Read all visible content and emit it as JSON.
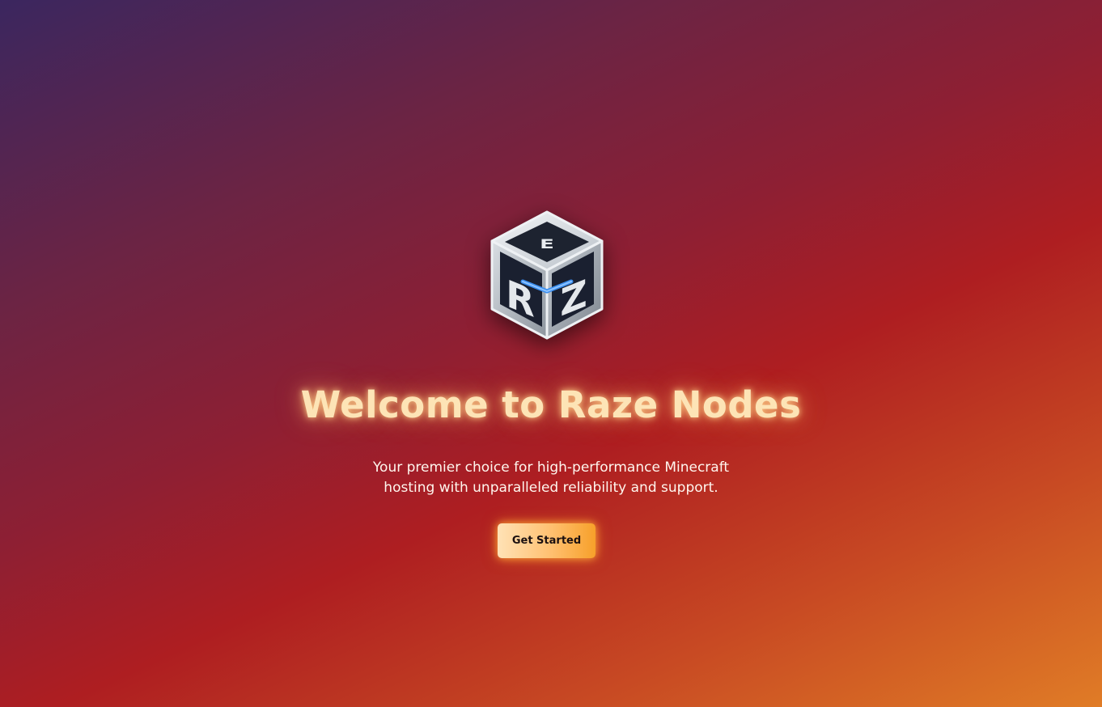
{
  "hero": {
    "logo_icon": "raze-nodes-cube-logo-icon",
    "logo_letters": [
      "R",
      "Z",
      "E"
    ],
    "title": "Welcome to Raze Nodes",
    "subtitle": "Your premier choice for high-performance Minecraft hosting with unparalleled reliability and support.",
    "cta_label": "Get Started"
  },
  "colors": {
    "title_glow": "#fde4b6",
    "button_start": "#ffe2b6",
    "button_end": "#f7a02a",
    "background_top_left": "#3b265f",
    "background_mid": "#ae1e21",
    "background_bottom_right": "#e07c26"
  }
}
